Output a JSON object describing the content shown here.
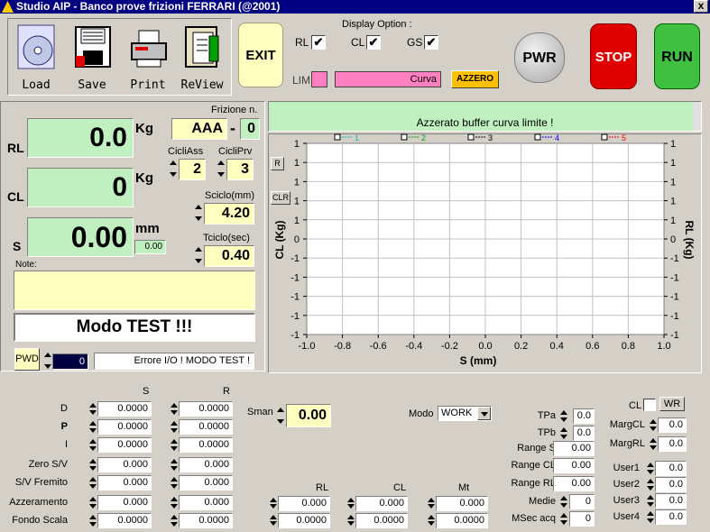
{
  "window": {
    "title": "Studio AIP - Banco prove frizioni FERRARI  (@2001)",
    "close": "x"
  },
  "toolbar": {
    "load": "Load",
    "save": "Save",
    "print": "Print",
    "review": "ReView"
  },
  "exit_label": "EXIT",
  "display_option": {
    "title": "Display Option :",
    "rl": {
      "label": "RL",
      "check": "✔"
    },
    "cl": {
      "label": "CL",
      "check": "✔"
    },
    "gs": {
      "label": "GS",
      "check": "✔"
    },
    "lim_label": "LIM",
    "curva": "Curva",
    "azzero": "AZZERO"
  },
  "buttons": {
    "pwr": "PWR",
    "stop": "STOP",
    "run": "RUN"
  },
  "readouts": {
    "rl": {
      "label": "RL",
      "value": "0.0",
      "unit": "Kg"
    },
    "cl": {
      "label": "CL",
      "value": "0",
      "unit": "Kg"
    },
    "s": {
      "label": "S",
      "value": "0.00",
      "unit": "mm",
      "sub": "0.00"
    }
  },
  "frizione": {
    "label": "Frizione n.",
    "code": "AAA",
    "dash": "-",
    "num": "0"
  },
  "cicli_ass": {
    "label": "CicliAss",
    "value": "2"
  },
  "cicli_prv": {
    "label": "CicliPrv",
    "value": "3"
  },
  "sciclo": {
    "label": "Sciclo(mm)",
    "value": "4.20"
  },
  "tciclo": {
    "label": "Tciclo(sec)",
    "value": "0.40"
  },
  "note_label": "Note:",
  "mode_banner": "Modo TEST !!!",
  "pwd": {
    "label": "PWD",
    "value": "0",
    "message": "Errore I/O ! MODO TEST !"
  },
  "message_bar": "Azzerato buffer curva limite !",
  "chart_data": {
    "type": "line",
    "xlabel": "S (mm)",
    "ylabel_left": "CL (Kg)",
    "ylabel_right": "RL (Kg)",
    "xlim": [
      -1.0,
      1.0
    ],
    "ylim": [
      -1,
      1
    ],
    "x_ticks": [
      "-1.0",
      "-0.8",
      "-0.6",
      "-0.4",
      "-0.2",
      "0.0",
      "0.2",
      "0.4",
      "0.6",
      "0.8",
      "1.0"
    ],
    "y_ticks": [
      "1",
      "1",
      "1",
      "1",
      "1",
      "0",
      "-1",
      "-1",
      "-1",
      "-1",
      "-1"
    ],
    "legend": [
      {
        "name": "1",
        "color": "#00c0c0"
      },
      {
        "name": "2",
        "color": "#00a000"
      },
      {
        "name": "3",
        "color": "#000000"
      },
      {
        "name": "4",
        "color": "#0000ff"
      },
      {
        "name": "5",
        "color": "#ff0000"
      }
    ],
    "series": [],
    "buttons": {
      "r": "R",
      "clr": "CLR"
    }
  },
  "table": {
    "col_s": "S",
    "col_r": "R",
    "rows": [
      {
        "label": "D",
        "s": "0.0000",
        "r": "0.0000"
      },
      {
        "label": "P",
        "s": "0.0000",
        "r": "0.0000"
      },
      {
        "label": "I",
        "s": "0.0000",
        "r": "0.0000"
      },
      {
        "label": "Zero S/V",
        "s": "0.000",
        "r": "0.000"
      },
      {
        "label": "S/V Fremito",
        "s": "0.000",
        "r": "0.000"
      },
      {
        "label": "Azzeramento",
        "s": "0.000",
        "r": "0.000"
      },
      {
        "label": "Fondo Scala",
        "s": "0.0000",
        "r": "0.0000"
      }
    ]
  },
  "sman": {
    "label": "Sman",
    "value": "0.00"
  },
  "modo": {
    "label": "Modo",
    "value": "WORK"
  },
  "mid": {
    "rl": "RL",
    "cl": "CL",
    "mt": "Mt",
    "rl1": "0.000",
    "rl2": "0.0000",
    "cl1": "0.000",
    "cl2": "0.0000",
    "mt1": "0.000",
    "mt2": "0.0000"
  },
  "right1": [
    {
      "label": "TPa",
      "value": "0.0"
    },
    {
      "label": "TPb",
      "value": "0.0"
    },
    {
      "label": "Range S",
      "value": "0.00"
    },
    {
      "label": "Range CL",
      "value": "0.00"
    },
    {
      "label": "Range RL",
      "value": "0.00"
    },
    {
      "label": "Medie",
      "value": "0"
    },
    {
      "label": "MSec acq",
      "value": "0"
    }
  ],
  "right2": {
    "cl_label": "CL",
    "wr": "WR",
    "marg": [
      {
        "label": "MargCL",
        "value": "0.0"
      },
      {
        "label": "MargRL",
        "value": "0.0"
      }
    ],
    "users": [
      {
        "label": "User1",
        "value": "0.0"
      },
      {
        "label": "User2",
        "value": "0.0"
      },
      {
        "label": "User3",
        "value": "0.0"
      },
      {
        "label": "User4",
        "value": "0.0"
      }
    ]
  }
}
